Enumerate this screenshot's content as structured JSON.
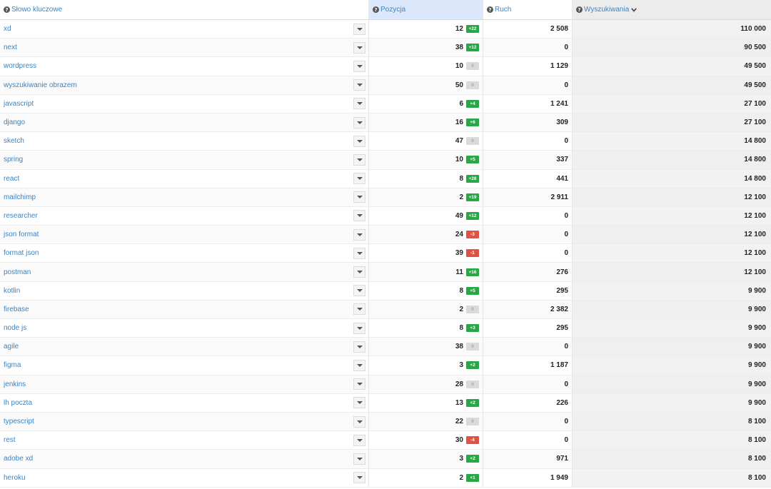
{
  "header": {
    "keyword": "Słowo kluczowe",
    "position": "Pozycja",
    "traffic": "Ruch",
    "searches": "Wyszukiwania"
  },
  "colors": {
    "link": "#3b84c4",
    "up": "#27a745",
    "down": "#e05243",
    "zero": "#dadada",
    "position_header": "#dbe8fb"
  },
  "rows": [
    {
      "keyword": "xd",
      "position": "12",
      "change": "+22",
      "trend": "up",
      "traffic": "2 508",
      "searches": "110 000"
    },
    {
      "keyword": "next",
      "position": "38",
      "change": "+12",
      "trend": "up",
      "traffic": "0",
      "searches": "90 500"
    },
    {
      "keyword": "wordpress",
      "position": "10",
      "change": "0",
      "trend": "zero",
      "traffic": "1 129",
      "searches": "49 500"
    },
    {
      "keyword": "wyszukiwanie obrazem",
      "position": "50",
      "change": "0",
      "trend": "zero",
      "traffic": "0",
      "searches": "49 500"
    },
    {
      "keyword": "javascript",
      "position": "6",
      "change": "+4",
      "trend": "up",
      "traffic": "1 241",
      "searches": "27 100"
    },
    {
      "keyword": "django",
      "position": "16",
      "change": "+6",
      "trend": "up",
      "traffic": "309",
      "searches": "27 100"
    },
    {
      "keyword": "sketch",
      "position": "47",
      "change": "0",
      "trend": "zero",
      "traffic": "0",
      "searches": "14 800"
    },
    {
      "keyword": "spring",
      "position": "10",
      "change": "+5",
      "trend": "up",
      "traffic": "337",
      "searches": "14 800"
    },
    {
      "keyword": "react",
      "position": "8",
      "change": "+28",
      "trend": "up",
      "traffic": "441",
      "searches": "14 800"
    },
    {
      "keyword": "mailchimp",
      "position": "2",
      "change": "+19",
      "trend": "up",
      "traffic": "2 911",
      "searches": "12 100"
    },
    {
      "keyword": "researcher",
      "position": "49",
      "change": "+12",
      "trend": "up",
      "traffic": "0",
      "searches": "12 100"
    },
    {
      "keyword": "json format",
      "position": "24",
      "change": "-3",
      "trend": "down",
      "traffic": "0",
      "searches": "12 100"
    },
    {
      "keyword": "format json",
      "position": "39",
      "change": "-1",
      "trend": "down",
      "traffic": "0",
      "searches": "12 100"
    },
    {
      "keyword": "postman",
      "position": "11",
      "change": "+16",
      "trend": "up",
      "traffic": "276",
      "searches": "12 100"
    },
    {
      "keyword": "kotlin",
      "position": "8",
      "change": "+5",
      "trend": "up",
      "traffic": "295",
      "searches": "9 900"
    },
    {
      "keyword": "firebase",
      "position": "2",
      "change": "0",
      "trend": "zero",
      "traffic": "2 382",
      "searches": "9 900"
    },
    {
      "keyword": "node js",
      "position": "8",
      "change": "+3",
      "trend": "up",
      "traffic": "295",
      "searches": "9 900"
    },
    {
      "keyword": "agile",
      "position": "38",
      "change": "0",
      "trend": "zero",
      "traffic": "0",
      "searches": "9 900"
    },
    {
      "keyword": "figma",
      "position": "3",
      "change": "+2",
      "trend": "up",
      "traffic": "1 187",
      "searches": "9 900"
    },
    {
      "keyword": "jenkins",
      "position": "28",
      "change": "0",
      "trend": "zero",
      "traffic": "0",
      "searches": "9 900"
    },
    {
      "keyword": "lh poczta",
      "position": "13",
      "change": "+2",
      "trend": "up",
      "traffic": "226",
      "searches": "9 900"
    },
    {
      "keyword": "typescript",
      "position": "22",
      "change": "0",
      "trend": "zero",
      "traffic": "0",
      "searches": "8 100"
    },
    {
      "keyword": "rest",
      "position": "30",
      "change": "-4",
      "trend": "down",
      "traffic": "0",
      "searches": "8 100"
    },
    {
      "keyword": "adobe xd",
      "position": "3",
      "change": "+2",
      "trend": "up",
      "traffic": "971",
      "searches": "8 100"
    },
    {
      "keyword": "heroku",
      "position": "2",
      "change": "+1",
      "trend": "up",
      "traffic": "1 949",
      "searches": "8 100"
    }
  ]
}
